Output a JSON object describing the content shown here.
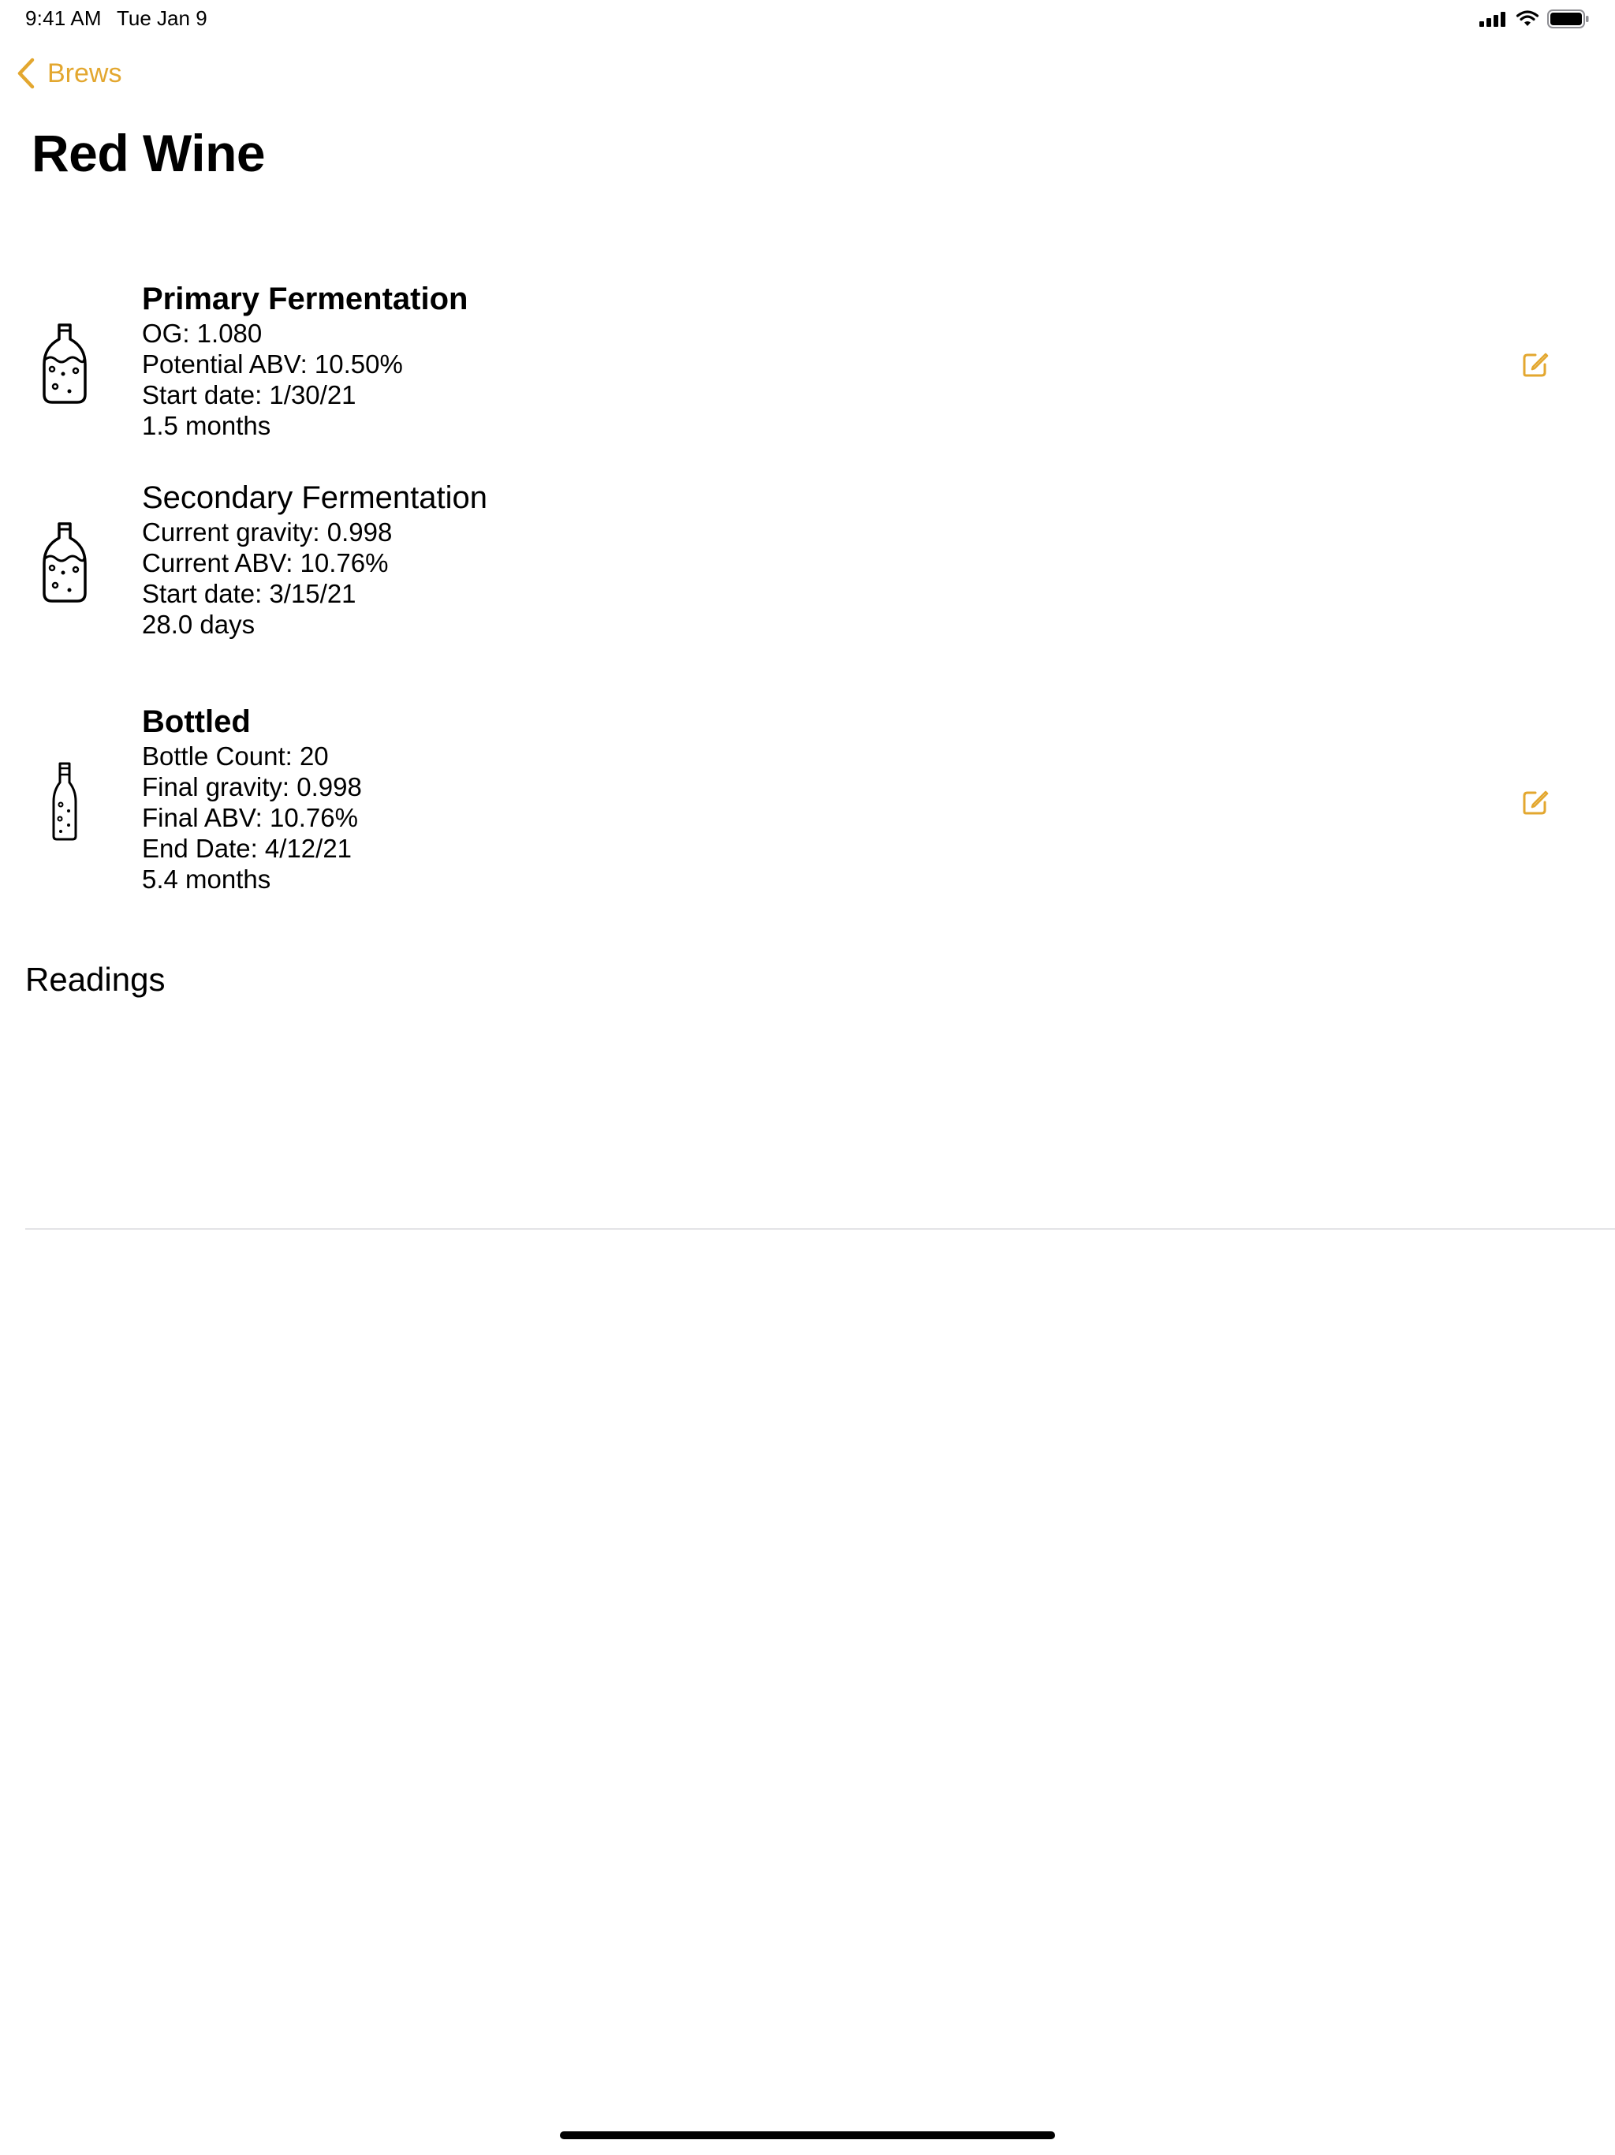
{
  "status_bar": {
    "time": "9:41 AM",
    "date": "Tue Jan 9"
  },
  "nav": {
    "back_label": "Brews"
  },
  "title": "Red Wine",
  "accent_color": "#E3A72F",
  "stages": [
    {
      "title": "Primary Fermentation",
      "icon": "carboy-icon",
      "lines": [
        "OG: 1.080",
        "Potential ABV: 10.50%",
        "Start date: 1/30/21",
        "1.5 months"
      ],
      "editable": true
    },
    {
      "title": "Secondary Fermentation",
      "icon": "carboy-icon",
      "lines": [
        "Current gravity: 0.998",
        "Current ABV: 10.76%",
        "Start date: 3/15/21",
        "28.0 days"
      ],
      "editable": false
    },
    {
      "title": "Bottled",
      "icon": "bottle-icon",
      "lines": [
        "Bottle Count: 20",
        "Final gravity: 0.998",
        "Final ABV: 10.76%",
        "End Date: 4/12/21",
        "5.4 months"
      ],
      "editable": true
    }
  ],
  "readings": {
    "title": "Readings"
  }
}
